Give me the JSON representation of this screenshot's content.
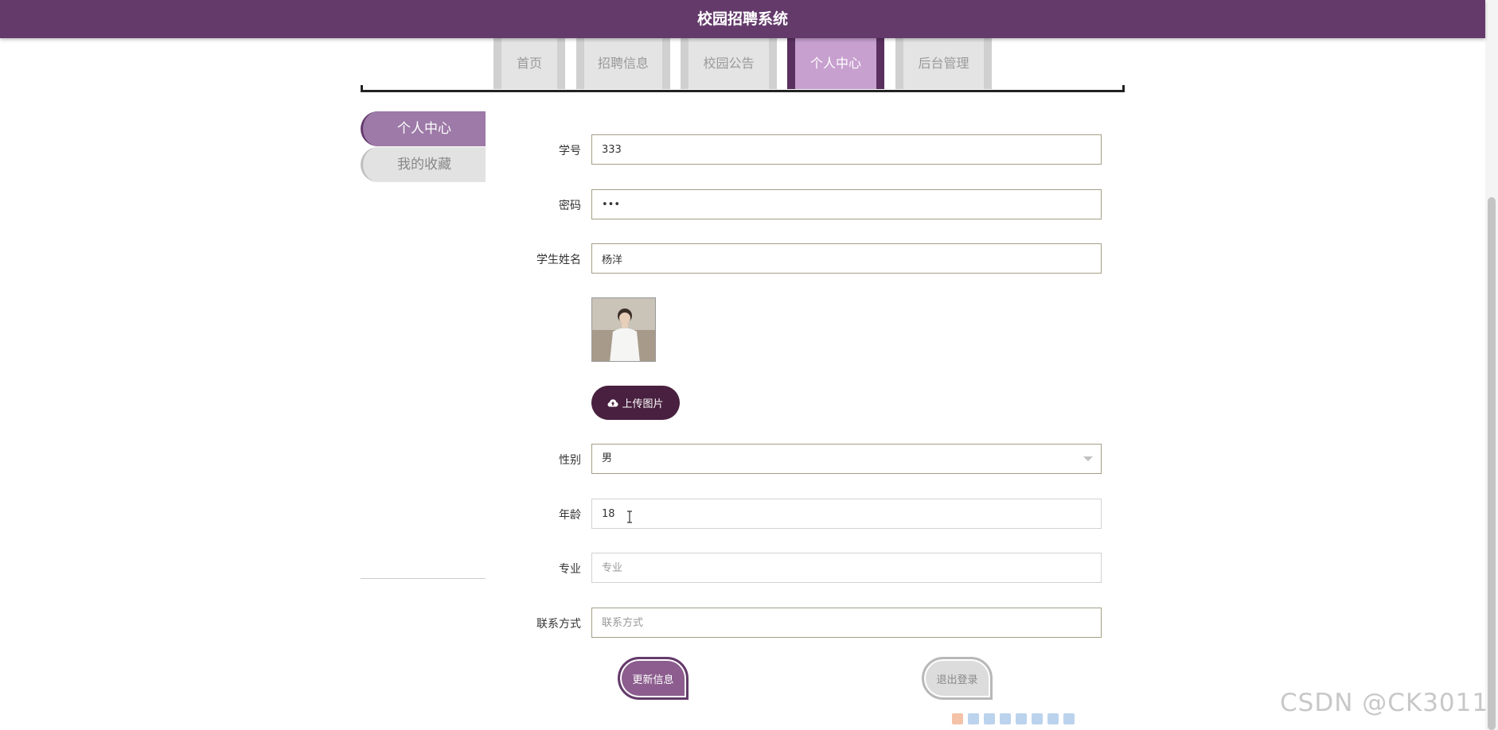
{
  "header": {
    "title": "校园招聘系统"
  },
  "nav": {
    "tabs": [
      {
        "label": "首页",
        "active": false
      },
      {
        "label": "招聘信息",
        "active": false
      },
      {
        "label": "校园公告",
        "active": false
      },
      {
        "label": "个人中心",
        "active": true
      },
      {
        "label": "后台管理",
        "active": false
      }
    ]
  },
  "sidebar": {
    "items": [
      {
        "label": "个人中心",
        "active": true
      },
      {
        "label": "我的收藏",
        "active": false
      }
    ]
  },
  "form": {
    "student_id": {
      "label": "学号",
      "value": "333"
    },
    "password": {
      "label": "密码",
      "value": "•••"
    },
    "student_name": {
      "label": "学生姓名",
      "value": "杨洋"
    },
    "avatar": {
      "icon": "user-photo"
    },
    "upload": {
      "label": "上传图片",
      "icon": "cloud-upload-icon"
    },
    "gender": {
      "label": "性别",
      "value": "男"
    },
    "age": {
      "label": "年龄",
      "value": "18"
    },
    "major": {
      "label": "专业",
      "value": "",
      "placeholder": "专业"
    },
    "contact": {
      "label": "联系方式",
      "value": "",
      "placeholder": "联系方式"
    }
  },
  "actions": {
    "update_label": "更新信息",
    "logout_label": "退出登录"
  },
  "watermark": "CSDN @CK3011",
  "colors": {
    "header": "#643a6b",
    "active_tab": "#c7a0cf",
    "accent_dark": "#49203f",
    "sidebar_active": "#9d7aa7"
  }
}
